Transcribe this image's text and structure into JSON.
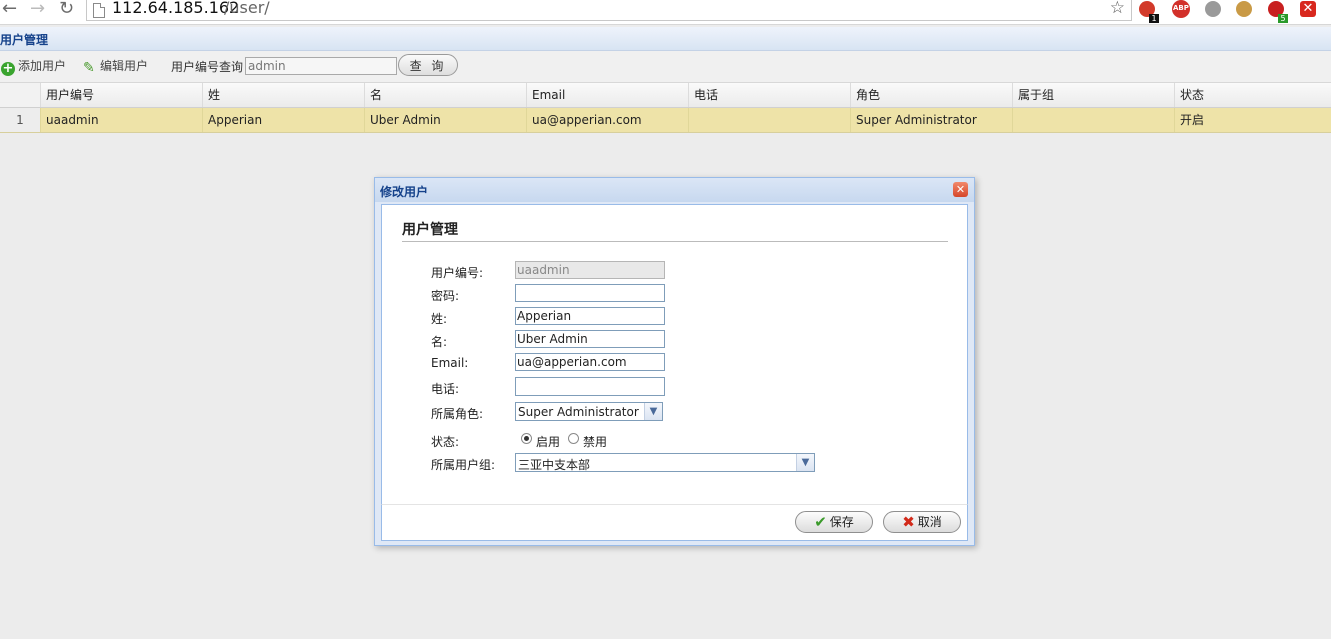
{
  "browser": {
    "url_host": "112.64.185.162",
    "url_path": "/user/",
    "extension_badges": [
      "1",
      "ABP",
      "5"
    ]
  },
  "panel": {
    "title": "用户管理"
  },
  "toolbar": {
    "add_label": "添加用户",
    "edit_label": "编辑用户",
    "search_label": "用户编号查询",
    "search_value": "admin",
    "query_label": "查 询"
  },
  "grid": {
    "columns": [
      "用户编号",
      "姓",
      "名",
      "Email",
      "电话",
      "角色",
      "属于组",
      "状态"
    ],
    "rows": [
      {
        "num": "1",
        "id": "uaadmin",
        "last": "Apperian",
        "first": "Uber Admin",
        "email": "ua@apperian.com",
        "phone": "",
        "role": "Super Administrator",
        "group": "",
        "status": "开启"
      }
    ]
  },
  "dialog": {
    "title": "修改用户",
    "section_title": "用户管理",
    "fields": {
      "user_id_label": "用户编号:",
      "user_id_value": "uaadmin",
      "password_label": "密码:",
      "password_value": "",
      "last_label": "姓:",
      "last_value": "Apperian",
      "first_label": "名:",
      "first_value": "Uber Admin",
      "email_label": "Email:",
      "email_value": "ua@apperian.com",
      "phone_label": "电话:",
      "phone_value": "",
      "role_label": "所属角色:",
      "role_value": "Super Administrator",
      "status_label": "状态:",
      "status_enabled": "启用",
      "status_disabled": "禁用",
      "group_label": "所属用户组:",
      "group_value": "三亚中支本部"
    },
    "save_label": "保存",
    "cancel_label": "取消"
  },
  "colors": {
    "selected_row": "#eee3a8",
    "title_blue": "#15428b",
    "window_border": "#99bbe8"
  }
}
